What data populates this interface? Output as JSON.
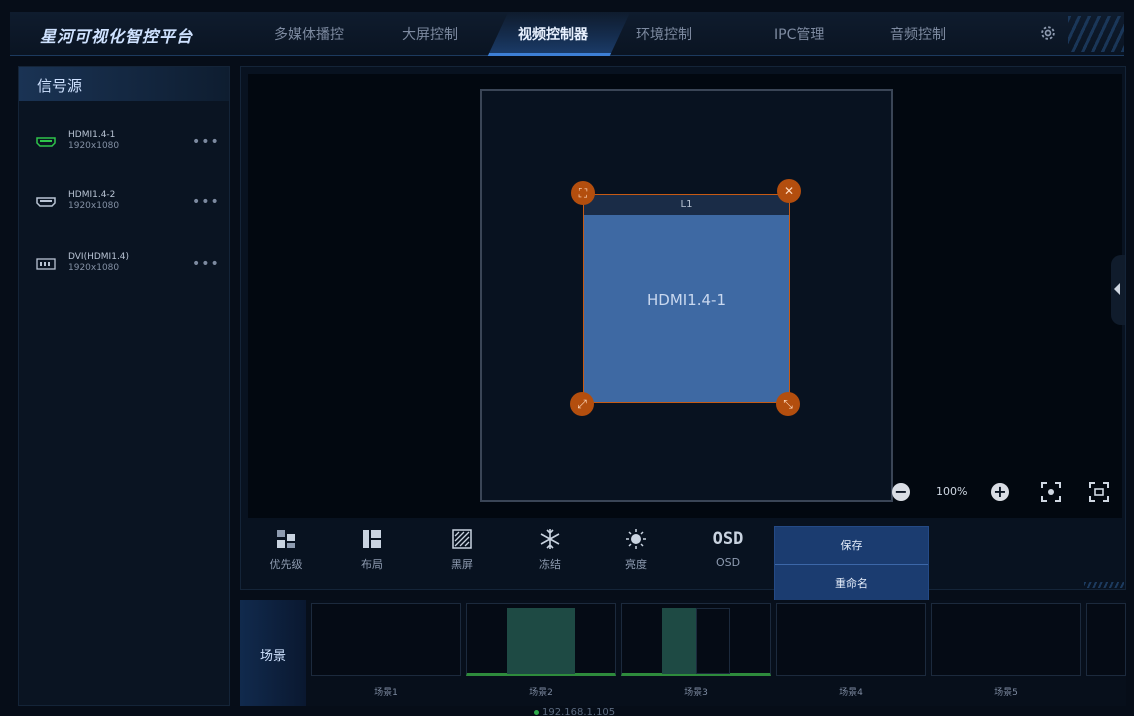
{
  "header": {
    "brand": "星河可视化智控平台",
    "tabs": [
      {
        "label": "多媒体播控",
        "active": false
      },
      {
        "label": "大屏控制",
        "active": false
      },
      {
        "label": "视频控制器",
        "active": true
      },
      {
        "label": "环境控制",
        "active": false
      },
      {
        "label": "IPC管理",
        "active": false
      },
      {
        "label": "音频控制",
        "active": false
      }
    ],
    "settings_icon": "gear-icon"
  },
  "sidebar": {
    "title": "信号源",
    "sources": [
      {
        "name": "HDMI1.4-1",
        "resolution": "1920x1080",
        "icon": "hdmi-icon",
        "icon_color": "#2ec44a",
        "more": "•••"
      },
      {
        "name": "HDMI1.4-2",
        "resolution": "1920x1080",
        "icon": "hdmi-icon",
        "icon_color": "#b9c4d4",
        "more": "•••"
      },
      {
        "name": "DVI(HDMI1.4)",
        "resolution": "1920x1080",
        "icon": "dvi-icon",
        "icon_color": "#b9c4d4",
        "more": "•••"
      }
    ]
  },
  "canvas": {
    "window": {
      "title": "L1",
      "source": "HDMI1.4-1"
    },
    "zoom": "100%",
    "zoom_out_symbol": "−",
    "zoom_in_symbol": "+"
  },
  "toolbar": {
    "tools": [
      {
        "label": "优先级",
        "icon": "priority-icon"
      },
      {
        "label": "布局",
        "icon": "layout-icon"
      },
      {
        "label": "黑屏",
        "icon": "blackscreen-icon"
      },
      {
        "label": "冻结",
        "icon": "freeze-icon"
      },
      {
        "label": "亮度",
        "icon": "brightness-icon"
      },
      {
        "label": "OSD",
        "icon": "osd-icon",
        "glyph": "OSD"
      }
    ],
    "menu": {
      "save": "保存",
      "rename": "重命名"
    }
  },
  "scenes": {
    "label": "场景",
    "items": [
      {
        "name": "场景1",
        "active": false
      },
      {
        "name": "场景2",
        "active": true
      },
      {
        "name": "场景3",
        "active": true
      },
      {
        "name": "场景4",
        "active": false
      },
      {
        "name": "场景5",
        "active": false
      }
    ]
  },
  "status": {
    "ip": "192.168.1.105"
  },
  "colors": {
    "accent": "#3d7fd6",
    "handle": "#b34e0e",
    "window": "#3e69a3",
    "active_scene": "#2e8b3c"
  }
}
